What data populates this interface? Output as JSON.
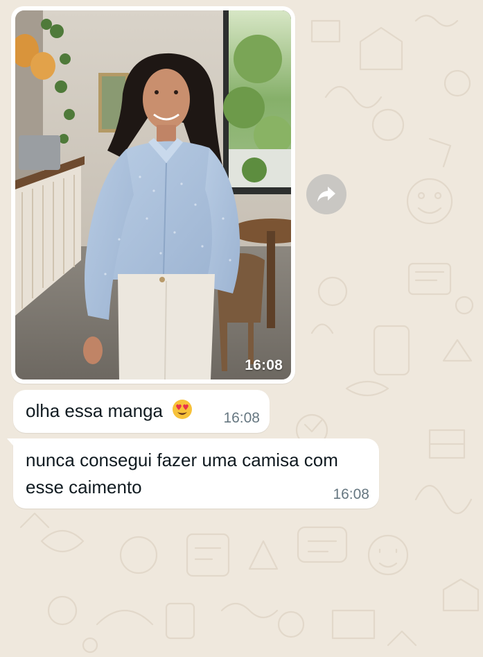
{
  "chat": {
    "image_message": {
      "time": "16:08",
      "photo_description_icon": "photo-image"
    },
    "forward_icon": "forward-arrow-icon",
    "messages": [
      {
        "text": "olha essa manga",
        "emoji": "smiling-face-with-heart-eyes",
        "time": "16:08"
      },
      {
        "text": "nunca consegui fazer uma camisa com esse caimento",
        "time": "16:08"
      }
    ]
  },
  "colors": {
    "wallpaper": "#efe8dd",
    "bubble": "#ffffff",
    "time_text": "#667781",
    "message_text": "#111b21",
    "forward_button": "#c9c7c3"
  }
}
